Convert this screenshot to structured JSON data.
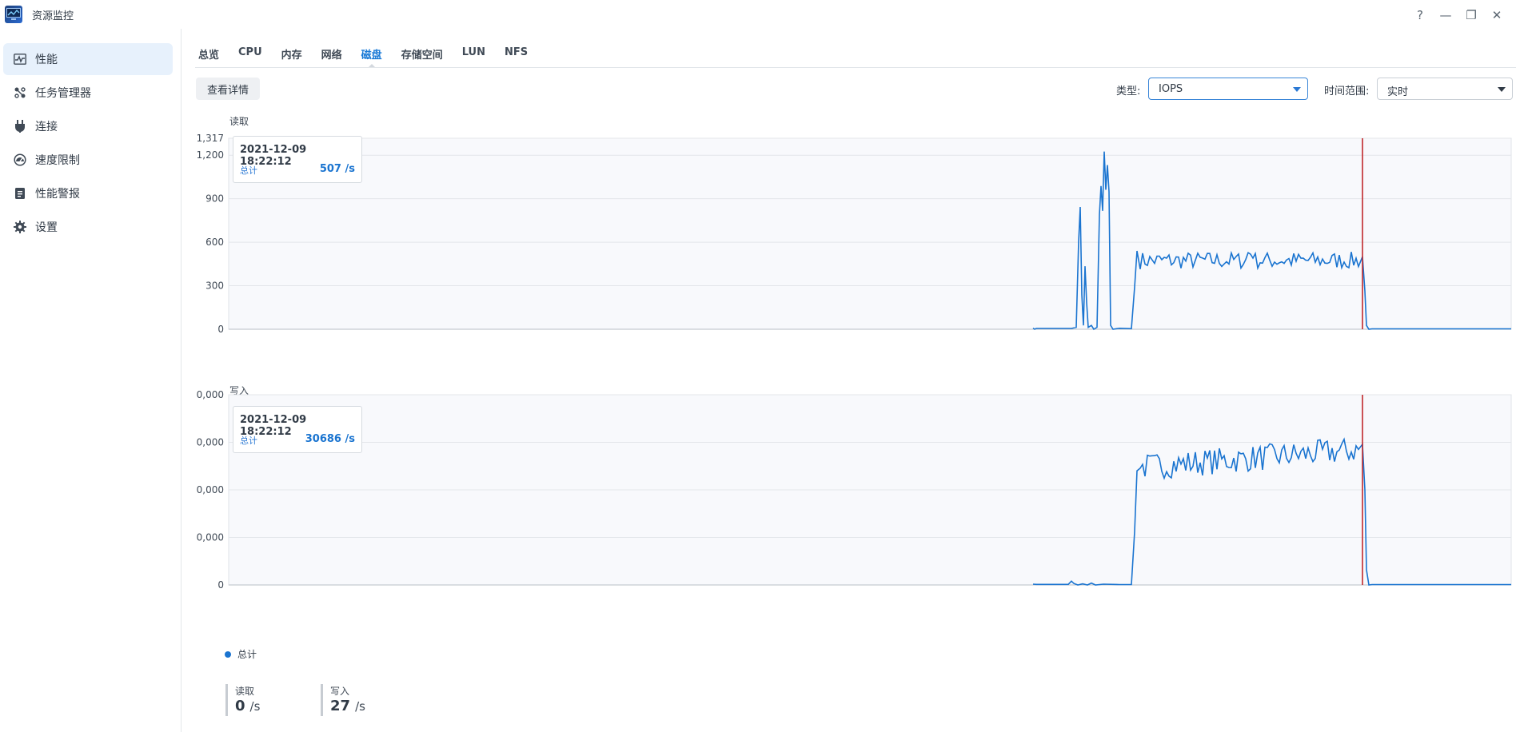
{
  "app": {
    "title": "资源监控",
    "help": "?",
    "minimize": "—",
    "restore": "❐",
    "close": "✕"
  },
  "sidebar": {
    "items": [
      {
        "label": "性能",
        "icon": "performance-icon"
      },
      {
        "label": "任务管理器",
        "icon": "task-manager-icon"
      },
      {
        "label": "连接",
        "icon": "plug-icon"
      },
      {
        "label": "速度限制",
        "icon": "speed-gauge-icon"
      },
      {
        "label": "性能警报",
        "icon": "alert-clipboard-icon"
      },
      {
        "label": "设置",
        "icon": "gear-icon"
      }
    ]
  },
  "tabs": [
    "总览",
    "CPU",
    "内存",
    "网络",
    "磁盘",
    "存储空间",
    "LUN",
    "NFS"
  ],
  "active_tab": "磁盘",
  "toolbar": {
    "detail_button": "查看详情",
    "type_label": "类型:",
    "type_value": "IOPS",
    "range_label": "时间范围:",
    "range_value": "实时"
  },
  "chart_data": [
    {
      "type": "line",
      "title": "读取",
      "ytick_labels": [
        "1,317",
        "1,200",
        "900",
        "600",
        "300",
        "0"
      ],
      "ylim": [
        0,
        1317
      ],
      "series": [
        {
          "name": "总计"
        }
      ],
      "tooltip": {
        "time": "2021-12-09 18:22:12",
        "name": "总计",
        "value": "507 /s"
      }
    },
    {
      "type": "line",
      "title": "写入",
      "ytick_labels": [
        "0,000",
        "0,000",
        "0,000",
        "0,000",
        "0"
      ],
      "ylim": [
        0,
        50000
      ],
      "series": [
        {
          "name": "总计"
        }
      ],
      "tooltip": {
        "time": "2021-12-09 18:22:12",
        "name": "总计",
        "value": "30686 /s"
      }
    }
  ],
  "legend": {
    "label": "总计",
    "color": "#1a74d0"
  },
  "stats": {
    "read": {
      "label": "读取",
      "value": "0",
      "unit": "/s"
    },
    "write": {
      "label": "写入",
      "value": "27",
      "unit": "/s"
    }
  },
  "colors": {
    "accent": "#1a7ad6",
    "line": "#1a74d0",
    "cursor": "#c0282b",
    "plot_bg": "#f8f9fc"
  }
}
